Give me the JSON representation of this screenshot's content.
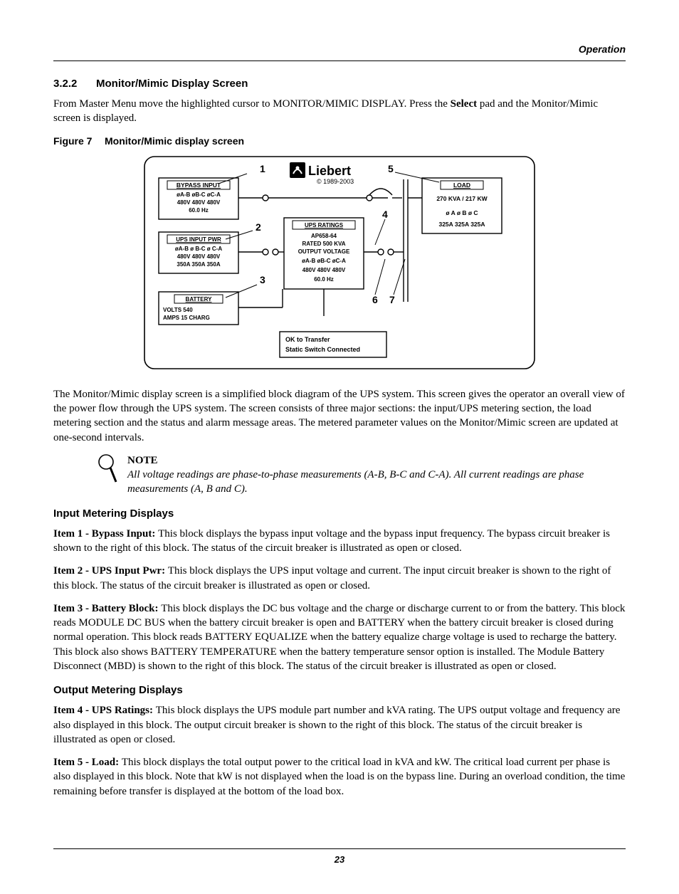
{
  "header": {
    "section": "Operation"
  },
  "section": {
    "number": "3.2.2",
    "title": "Monitor/Mimic Display Screen",
    "intro_a": "From Master Menu move the highlighted cursor to MONITOR/MIMIC DISPLAY. Press the ",
    "intro_select": "Select",
    "intro_b": " pad and the Monitor/Mimic screen is displayed."
  },
  "figure": {
    "label": "Figure 7",
    "caption": "Monitor/Mimic display screen",
    "brand": "Liebert",
    "copyright": "© 1989-2003",
    "callouts": {
      "1": "1",
      "2": "2",
      "3": "3",
      "4": "4",
      "5": "5",
      "6": "6",
      "7": "7"
    },
    "bypass_input": {
      "title": "BYPASS INPUT",
      "hdr": "øA-B   øB-C  øC-A",
      "volts": "480V   480V   480V",
      "hz": "60.0 Hz"
    },
    "ups_input_pwr": {
      "title": "UPS INPUT PWR",
      "hdr": "øA-B  ø B-C  ø C-A",
      "volts": "480V   480V   480V",
      "amps": "350A   350A  350A"
    },
    "battery": {
      "title": "BATTERY",
      "volts": "VOLTS 540",
      "amps": "AMPS 15 CHARG"
    },
    "ups_ratings": {
      "title": "UPS RATINGS",
      "part": "AP658-64",
      "kva": "RATED 500 KVA",
      "out": "OUTPUT VOLTAGE",
      "hdr": "øA-B  øB-C  øC-A",
      "volts": "480V   480V   480V",
      "hz": "60.0 Hz"
    },
    "load": {
      "title": "LOAD",
      "power": "270 KVA / 217 KW",
      "hdr": "ø A      ø B     ø C",
      "amps": "325A    325A   325A"
    },
    "status": {
      "l1": "OK to Transfer",
      "l2": "Static Switch Connected"
    }
  },
  "body": {
    "desc": "The Monitor/Mimic display screen is a simplified block diagram of the UPS system. This screen gives the operator an overall view of the power flow through the UPS system. The screen consists of three major sections: the input/UPS metering section, the load metering section and the status and alarm message areas. The metered parameter values on the Monitor/Mimic screen are updated at one-second intervals.",
    "note_title": "NOTE",
    "note_body": "All voltage readings are phase-to-phase measurements (A-B, B-C and C-A). All current readings are phase measurements (A, B and C).",
    "input_heading": "Input Metering Displays",
    "item1_head": "Item 1 - Bypass Input: ",
    "item1_body": "This block displays the bypass input voltage and the bypass input frequency. The bypass circuit breaker is shown to the right of this block. The status of the circuit breaker is illustrated as open or closed.",
    "item2_head": "Item 2 - UPS Input Pwr: ",
    "item2_body": "This block displays the UPS input voltage and current. The input circuit breaker is shown to the right of this block. The status of the circuit breaker is illustrated as open or closed.",
    "item3_head": "Item 3 - Battery Block: ",
    "item3_body": "This block displays the DC bus voltage and the charge or discharge current to or from the battery. This block reads MODULE DC BUS when the battery circuit breaker is open and BATTERY when the battery circuit breaker is closed during normal operation. This block reads BATTERY EQUALIZE when the battery equalize charge voltage is used to recharge the battery. This block also shows BATTERY TEMPERATURE when the battery temperature sensor option is installed. The Module Battery Disconnect (MBD) is shown to the right of this block. The status of the circuit breaker is illustrated as open or closed.",
    "output_heading": "Output Metering Displays",
    "item4_head": "Item 4 - UPS Ratings: ",
    "item4_body": "This block displays the UPS module part number and kVA rating. The UPS output voltage and frequency are also displayed in this block. The output circuit breaker is shown to the right of this block. The status of the circuit breaker is illustrated as open or closed.",
    "item5_head": "Item 5 - Load: ",
    "item5_body": "This block displays the total output power to the critical load in kVA and kW. The critical load current per phase is also displayed in this block. Note that kW is not displayed when the load is on the bypass line. During an overload condition, the time remaining before transfer is displayed at the bottom of the load box."
  },
  "footer": {
    "page": "23"
  }
}
